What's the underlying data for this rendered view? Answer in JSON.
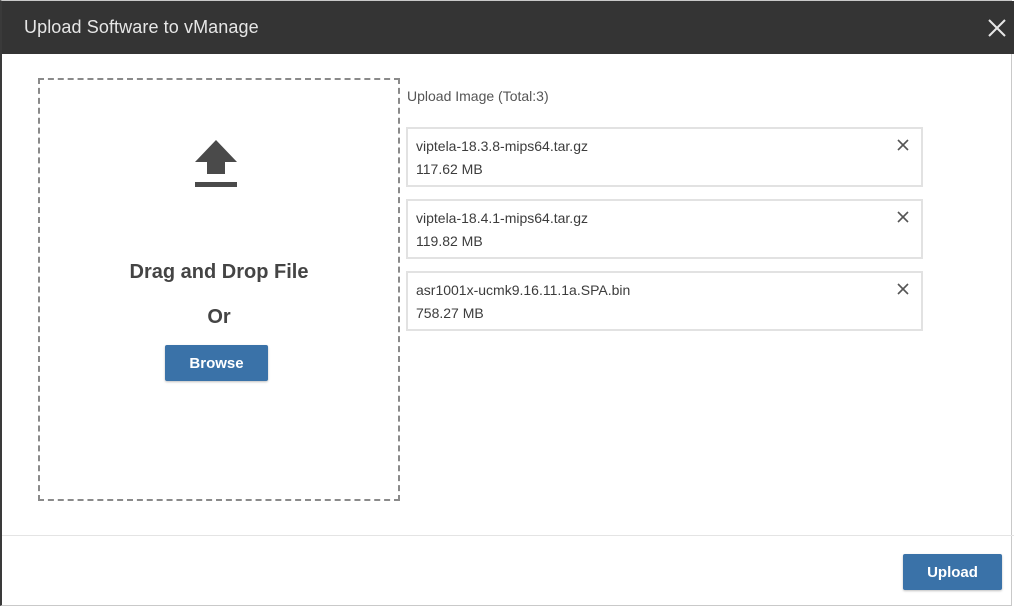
{
  "dialog": {
    "title": "Upload Software to vManage",
    "close_icon": "close-icon"
  },
  "dropzone": {
    "icon": "upload-icon",
    "drag_text": "Drag and Drop File",
    "or_text": "Or",
    "browse_label": "Browse"
  },
  "file_list": {
    "header": "Upload Image (Total:3)",
    "items": [
      {
        "name": "viptela-18.3.8-mips64.tar.gz",
        "size": "117.62 MB",
        "remove_icon": "close-icon"
      },
      {
        "name": "viptela-18.4.1-mips64.tar.gz",
        "size": "119.82 MB",
        "remove_icon": "close-icon"
      },
      {
        "name": "asr1001x-ucmk9.16.11.1a.SPA.bin",
        "size": "758.27 MB",
        "remove_icon": "close-icon"
      }
    ]
  },
  "footer": {
    "upload_label": "Upload"
  },
  "colors": {
    "titlebar": "#343434",
    "primary_button": "#3a72a8",
    "text": "#3c3c3c"
  }
}
